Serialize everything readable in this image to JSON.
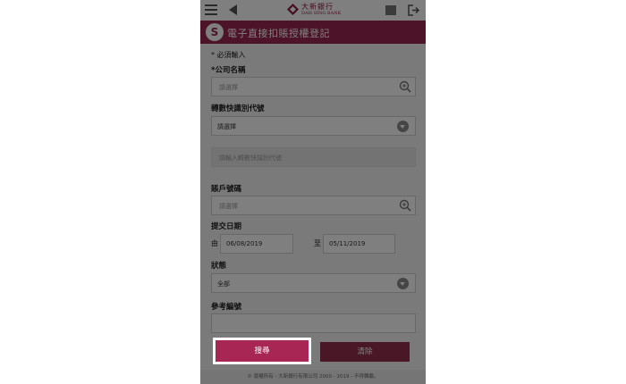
{
  "header": {
    "bank_name_cn": "大新銀行",
    "bank_name_en": "DAH SING BANK",
    "menu_icon": "hamburger-menu-icon",
    "back_icon": "back-arrow-icon",
    "flag_icon": "flag-icon",
    "logout_icon": "logout-icon"
  },
  "title": "電子直接扣賬授權登記",
  "form": {
    "required_note": "* 必須輸入",
    "company_label": "*公司名稱",
    "company_placeholder": "請選擇",
    "transfer_code_label": "轉數快識別代號",
    "transfer_code_value": "請選擇",
    "transfer_code_input_placeholder": "請輸入轉數快識別代號",
    "account_label": "賬戶號碼",
    "account_placeholder": "請選擇",
    "date_label": "提交日期",
    "from_label": "由",
    "from_date": "06/08/2019",
    "to_label": "至",
    "to_date": "05/11/2019",
    "status_label": "狀態",
    "status_value": "全部",
    "ref_label": "參考編號",
    "ref_value": ""
  },
  "buttons": {
    "search": "搜尋",
    "clear": "清除"
  },
  "footer": "© 版權所有 - 大新銀行有限公司 2000 - 2019 - 不得轉載。",
  "colors": {
    "brand": "#9b2650",
    "button": "#8b1a3a",
    "highlight_border": "#ffffff"
  }
}
